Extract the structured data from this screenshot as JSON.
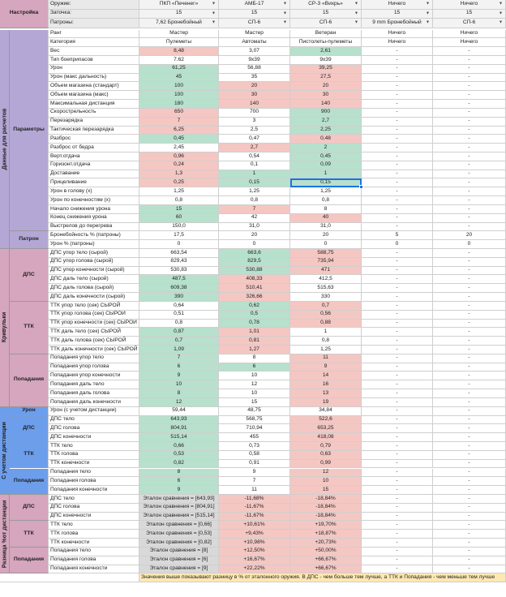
{
  "colors": {
    "green": "#b7e1cd",
    "red": "#f4c7c3",
    "purple": "#b4a7d6",
    "pink": "#d5a6bd",
    "blue": "#6d9eeb",
    "gray": "#d9d9d9",
    "yellow": "#fce8b2",
    "header": "#e9e9e9"
  },
  "sidebar": {
    "settings": "Настройка",
    "damage_calc": "Данные для расчетов",
    "params": "Параметры",
    "cartridge": "Патрон",
    "dps_raw": "ДПС",
    "ttk_raw": "ТТК",
    "hits": "Попадания",
    "trash": "Кривульки",
    "dist_dmg": "Урон",
    "dist_dps": "ДПС",
    "dist_ttk": "ТТК",
    "dist_hits": "Попадания",
    "dist_group": "С учетом дистанции",
    "diff_dps": "ДПС",
    "diff_ttk": "ТТК",
    "diff_hits": "Попадания",
    "diff_group": "Разница %от дистанции"
  },
  "settings_rows": [
    {
      "label": "Оружие:",
      "values": [
        "ПКП «Печенег»",
        "АМБ-17",
        "СР-3 «Вихрь»",
        "Ничего",
        "Ничего"
      ]
    },
    {
      "label": "Заточка:",
      "values": [
        "15",
        "15",
        "15",
        "15",
        "15"
      ]
    },
    {
      "label": "Патроны:",
      "values": [
        "7,62 Бронебойный",
        "СП-6",
        "СП-6",
        "9 mm Бронебойный",
        "СП-6"
      ]
    }
  ],
  "rows": [
    {
      "label": "Ранг",
      "values": [
        "Мастер",
        "Мастер",
        "Ветеран",
        "Ничего",
        "Ничего"
      ],
      "colors": [
        "",
        "",
        "",
        "",
        ""
      ]
    },
    {
      "label": "Категория",
      "values": [
        "Пулеметы",
        "Автоматы",
        "Пистолеты-пулеметы",
        "Ничего",
        "Ничего"
      ],
      "colors": [
        "",
        "",
        "",
        "",
        ""
      ]
    },
    {
      "label": "Вес",
      "values": [
        "8,48",
        "3,07",
        "2,61",
        "-",
        "-"
      ],
      "colors": [
        "red",
        "",
        "green",
        "",
        ""
      ]
    },
    {
      "label": "Тип боеприпасов",
      "values": [
        "7.62",
        "9x39",
        "9x39",
        "-",
        "-"
      ],
      "colors": [
        "",
        "",
        "",
        "",
        ""
      ]
    },
    {
      "label": "Урон",
      "values": [
        "61,25",
        "56,88",
        "39,25",
        "-",
        "-"
      ],
      "colors": [
        "green",
        "",
        "red",
        "",
        ""
      ]
    },
    {
      "label": "Урон (макс дальность)",
      "values": [
        "45",
        "35",
        "27,5",
        "-",
        "-"
      ],
      "colors": [
        "green",
        "",
        "red",
        "",
        ""
      ]
    },
    {
      "label": "Объем магазина (стандарт)",
      "values": [
        "100",
        "20",
        "20",
        "-",
        "-"
      ],
      "colors": [
        "green",
        "red",
        "red",
        "",
        ""
      ]
    },
    {
      "label": "Объем магазина (макс)",
      "values": [
        "100",
        "30",
        "30",
        "-",
        "-"
      ],
      "colors": [
        "green",
        "red",
        "red",
        "",
        ""
      ]
    },
    {
      "label": "Максимальная дистанция",
      "values": [
        "180",
        "140",
        "140",
        "-",
        "-"
      ],
      "colors": [
        "green",
        "red",
        "red",
        "",
        ""
      ]
    },
    {
      "label": "Скорострельность",
      "values": [
        "650",
        "700",
        "900",
        "-",
        "-"
      ],
      "colors": [
        "red",
        "",
        "green",
        "",
        ""
      ]
    },
    {
      "label": "Перезарядка",
      "values": [
        "7",
        "3",
        "2,7",
        "-",
        "-"
      ],
      "colors": [
        "red",
        "",
        "green",
        "",
        ""
      ]
    },
    {
      "label": "Тактическая перезарядка",
      "values": [
        "6,25",
        "2,5",
        "2,25",
        "-",
        "-"
      ],
      "colors": [
        "red",
        "",
        "green",
        "",
        ""
      ]
    },
    {
      "label": "Разброс",
      "values": [
        "0,45",
        "0,47",
        "0,48",
        "-",
        "-"
      ],
      "colors": [
        "green",
        "",
        "red",
        "",
        ""
      ]
    },
    {
      "label": "Разброс от бедра",
      "values": [
        "2,45",
        "2,7",
        "2",
        "-",
        "-"
      ],
      "colors": [
        "",
        "red",
        "green",
        "",
        ""
      ]
    },
    {
      "label": "Верт.отдача",
      "values": [
        "0,96",
        "0,54",
        "0,45",
        "-",
        "-"
      ],
      "colors": [
        "red",
        "",
        "green",
        "",
        ""
      ]
    },
    {
      "label": "Горизонт.отдача",
      "values": [
        "0,24",
        "0,1",
        "0,09",
        "-",
        "-"
      ],
      "colors": [
        "red",
        "",
        "green",
        "",
        ""
      ]
    },
    {
      "label": "Доставание",
      "values": [
        "1,3",
        "1",
        "1",
        "-",
        "-"
      ],
      "colors": [
        "red",
        "green",
        "green",
        "",
        ""
      ]
    },
    {
      "label": "Прицеливание",
      "values": [
        "0,25",
        "0,15",
        "0,15",
        "-",
        "-"
      ],
      "colors": [
        "red",
        "green",
        "green",
        "",
        ""
      ]
    },
    {
      "label": "Урон в голову (x)",
      "values": [
        "1,25",
        "1,25",
        "1,25",
        "-",
        "-"
      ],
      "colors": [
        "",
        "",
        "",
        "",
        ""
      ]
    },
    {
      "label": "Урон по конечностям (x)",
      "values": [
        "0,8",
        "0,8",
        "0,8",
        "-",
        "-"
      ],
      "colors": [
        "",
        "",
        "",
        "",
        ""
      ]
    },
    {
      "label": "Начало снижения урона",
      "values": [
        "15",
        "7",
        "8",
        "-",
        "-"
      ],
      "colors": [
        "green",
        "red",
        "",
        "",
        ""
      ]
    },
    {
      "label": "Конец снижения урона",
      "values": [
        "60",
        "42",
        "40",
        "-",
        "-"
      ],
      "colors": [
        "green",
        "",
        "red",
        "",
        ""
      ]
    },
    {
      "label": "Выстрелов до перегрева",
      "values": [
        "150,0",
        "31,0",
        "31,0",
        "-",
        "-"
      ],
      "colors": [
        "",
        "",
        "",
        "",
        ""
      ]
    },
    {
      "label": "Бронебойность % (патроны)",
      "values": [
        "17,5",
        "20",
        "20",
        "5",
        "20"
      ],
      "colors": [
        "",
        "",
        "",
        "",
        ""
      ]
    },
    {
      "label": "Урон % (патроны)",
      "values": [
        "0",
        "0",
        "0",
        "0",
        "0"
      ],
      "colors": [
        "",
        "",
        "",
        "",
        ""
      ]
    },
    {
      "label": "ДПС упор тело (сырой)",
      "values": [
        "663,54",
        "663,6",
        "588,75",
        "-",
        "-"
      ],
      "colors": [
        "",
        "green",
        "red",
        "",
        ""
      ]
    },
    {
      "label": "ДПС упор голова (сырой)",
      "values": [
        "829,43",
        "829,5",
        "735,94",
        "-",
        "-"
      ],
      "colors": [
        "",
        "green",
        "red",
        "",
        ""
      ]
    },
    {
      "label": "ДПС упор конечности (сырой)",
      "values": [
        "530,83",
        "530,88",
        "471",
        "-",
        "-"
      ],
      "colors": [
        "",
        "green",
        "red",
        "",
        ""
      ]
    },
    {
      "label": "ДПС даль тело (сырой)",
      "values": [
        "487,5",
        "408,33",
        "412,5",
        "-",
        "-"
      ],
      "colors": [
        "green",
        "red",
        "",
        "",
        ""
      ]
    },
    {
      "label": "ДПС даль голова (сырой)",
      "values": [
        "609,38",
        "510,41",
        "515,63",
        "-",
        "-"
      ],
      "colors": [
        "green",
        "red",
        "",
        "",
        ""
      ]
    },
    {
      "label": "ДПС даль конечности (сырой)",
      "values": [
        "390",
        "326,66",
        "330",
        "-",
        "-"
      ],
      "colors": [
        "green",
        "red",
        "",
        "",
        ""
      ]
    },
    {
      "label": "ТТК упор тело (сек) СЫРОЙ",
      "values": [
        "0,64",
        "0,62",
        "0,7",
        "-",
        "-"
      ],
      "colors": [
        "",
        "green",
        "red",
        "",
        ""
      ]
    },
    {
      "label": "ТТК упор голова (сек) СЫРОЙ",
      "values": [
        "0,51",
        "0,5",
        "0,56",
        "-",
        "-"
      ],
      "colors": [
        "",
        "green",
        "red",
        "",
        ""
      ]
    },
    {
      "label": "ТТК упор конечности (сек) СЫРОЙ",
      "values": [
        "0,8",
        "0,78",
        "0,88",
        "-",
        "-"
      ],
      "colors": [
        "",
        "green",
        "red",
        "",
        ""
      ]
    },
    {
      "label": "ТТК даль тело (сек) СЫРОЙ",
      "values": [
        "0,87",
        "1,01",
        "1",
        "-",
        "-"
      ],
      "colors": [
        "green",
        "red",
        "",
        "",
        ""
      ]
    },
    {
      "label": "ТТК даль голова (сек) СЫРОЙ",
      "values": [
        "0,7",
        "0,81",
        "0,8",
        "-",
        "-"
      ],
      "colors": [
        "green",
        "red",
        "",
        "",
        ""
      ]
    },
    {
      "label": "ТТК даль конечности (сек) СЫРОЙ",
      "values": [
        "1,09",
        "1,27",
        "1,25",
        "-",
        "-"
      ],
      "colors": [
        "green",
        "red",
        "",
        "",
        ""
      ]
    },
    {
      "label": "Попадания упор тело",
      "values": [
        "7",
        "8",
        "11",
        "-",
        "-"
      ],
      "colors": [
        "green",
        "",
        "red",
        "",
        ""
      ]
    },
    {
      "label": "Попадания упор голова",
      "values": [
        "6",
        "6",
        "9",
        "-",
        "-"
      ],
      "colors": [
        "green",
        "green",
        "red",
        "",
        ""
      ]
    },
    {
      "label": "Попадания упор конечности",
      "values": [
        "9",
        "10",
        "14",
        "-",
        "-"
      ],
      "colors": [
        "green",
        "",
        "red",
        "",
        ""
      ]
    },
    {
      "label": "Попадания даль тело",
      "values": [
        "10",
        "12",
        "16",
        "-",
        "-"
      ],
      "colors": [
        "green",
        "",
        "red",
        "",
        ""
      ]
    },
    {
      "label": "Попадания даль голова",
      "values": [
        "8",
        "10",
        "13",
        "-",
        "-"
      ],
      "colors": [
        "green",
        "",
        "red",
        "",
        ""
      ]
    },
    {
      "label": "Попадания даль конечности",
      "values": [
        "12",
        "15",
        "19",
        "-",
        "-"
      ],
      "colors": [
        "green",
        "",
        "red",
        "",
        ""
      ]
    },
    {
      "label": "Урон (с учетом дистанции)",
      "values": [
        "59,44",
        "48,75",
        "34,84",
        "-",
        "-"
      ],
      "colors": [
        "",
        "",
        "",
        "",
        ""
      ]
    },
    {
      "label": "ДПС тело",
      "values": [
        "643,93",
        "568,75",
        "522,6",
        "-",
        "-"
      ],
      "colors": [
        "green",
        "",
        "red",
        "",
        ""
      ]
    },
    {
      "label": "ДПС голова",
      "values": [
        "804,91",
        "710,94",
        "653,25",
        "-",
        "-"
      ],
      "colors": [
        "green",
        "",
        "red",
        "",
        ""
      ]
    },
    {
      "label": "ДПС конечности",
      "values": [
        "515,14",
        "455",
        "418,08",
        "-",
        "-"
      ],
      "colors": [
        "green",
        "",
        "red",
        "",
        ""
      ]
    },
    {
      "label": "ТТК тело",
      "values": [
        "0,66",
        "0,73",
        "0,79",
        "-",
        "-"
      ],
      "colors": [
        "green",
        "",
        "red",
        "",
        ""
      ]
    },
    {
      "label": "ТТК голова",
      "values": [
        "0,53",
        "0,58",
        "0,63",
        "-",
        "-"
      ],
      "colors": [
        "green",
        "",
        "red",
        "",
        ""
      ]
    },
    {
      "label": "ТТК конечности",
      "values": [
        "0,82",
        "0,91",
        "0,99",
        "-",
        "-"
      ],
      "colors": [
        "green",
        "",
        "red",
        "",
        ""
      ]
    },
    {
      "label": "Попадания тело",
      "values": [
        "8",
        "9",
        "12",
        "-",
        "-"
      ],
      "colors": [
        "green",
        "",
        "red",
        "",
        ""
      ]
    },
    {
      "label": "Попадания голова",
      "values": [
        "6",
        "7",
        "10",
        "-",
        "-"
      ],
      "colors": [
        "green",
        "",
        "red",
        "",
        ""
      ]
    },
    {
      "label": "Попадания конечности",
      "values": [
        "9",
        "11",
        "15",
        "-",
        "-"
      ],
      "colors": [
        "green",
        "",
        "red",
        "",
        ""
      ]
    },
    {
      "label": "ДПС тело",
      "values": [
        "Эталон сравнения = [643,93]",
        "-11,68%",
        "-18,84%",
        "-",
        "-"
      ],
      "colors": [
        "gray",
        "red",
        "red",
        "",
        ""
      ]
    },
    {
      "label": "ДПС голова",
      "values": [
        "Эталон сравнения = [804,91]",
        "-11,67%",
        "-18,84%",
        "-",
        "-"
      ],
      "colors": [
        "gray",
        "red",
        "red",
        "",
        ""
      ]
    },
    {
      "label": "ДПС конечности",
      "values": [
        "Эталон сравнения = [515,14]",
        "-11,67%",
        "-18,84%",
        "-",
        "-"
      ],
      "colors": [
        "gray",
        "red",
        "red",
        "",
        ""
      ]
    },
    {
      "label": "ТТК тело",
      "values": [
        "Эталон сравнения = [0,66]",
        "+10,61%",
        "+19,70%",
        "-",
        "-"
      ],
      "colors": [
        "gray",
        "red",
        "red",
        "",
        ""
      ]
    },
    {
      "label": "ТТК голова",
      "values": [
        "Эталон сравнения = [0,53]",
        "+9,43%",
        "+18,87%",
        "-",
        "-"
      ],
      "colors": [
        "gray",
        "red",
        "red",
        "",
        ""
      ]
    },
    {
      "label": "ТТК конечности",
      "values": [
        "Эталон сравнения = [0,82]",
        "+10,98%",
        "+20,73%",
        "-",
        "-"
      ],
      "colors": [
        "gray",
        "red",
        "red",
        "",
        ""
      ]
    },
    {
      "label": "Попадания тело",
      "values": [
        "Эталон сравнения = [8]",
        "+12,50%",
        "+50,00%",
        "-",
        "-"
      ],
      "colors": [
        "gray",
        "red",
        "red",
        "",
        ""
      ]
    },
    {
      "label": "Попадания голова",
      "values": [
        "Эталон сравнения = [6]",
        "+16,67%",
        "+66,67%",
        "-",
        "-"
      ],
      "colors": [
        "gray",
        "red",
        "red",
        "",
        ""
      ]
    },
    {
      "label": "Попадания конечности",
      "values": [
        "Эталон сравнения = [9]",
        "+22,22%",
        "+66,67%",
        "-",
        "-"
      ],
      "colors": [
        "gray",
        "red",
        "red",
        "",
        ""
      ]
    }
  ],
  "footnote": "Значения выше показывают разницу в % от эталонного оружия. В ДПС - чем больше тем лучше, а ТТК и Попадания - чем меньше тем лучше"
}
